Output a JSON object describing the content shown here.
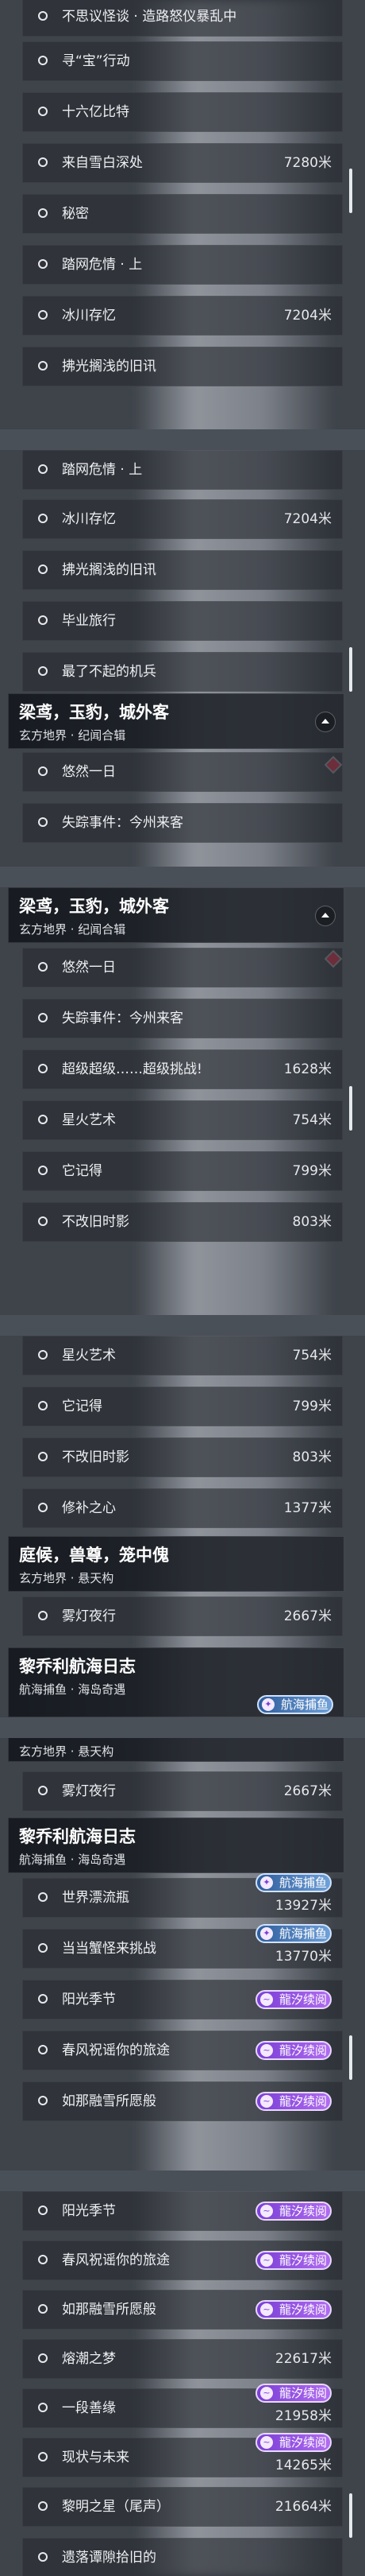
{
  "tags": {
    "longxi": "龍汐续阅",
    "hanghai": "航海捕鱼"
  },
  "chapters": {
    "liangniao": {
      "title": "梁鸢，玉豹，城外客",
      "sub": "玄方地界 · 纪闻合辑"
    },
    "tinghou": {
      "title": "庭候，兽尊，笼中傀",
      "sub": "玄方地界 · 悬天构"
    },
    "liqiao": {
      "title": "黎乔利航海日志",
      "sub": "航海捕鱼 · 海岛奇遇"
    }
  },
  "quests": {
    "q1": {
      "title": "不思议怪谈 · 造路怒仪暴乱中"
    },
    "q2": {
      "title": "寻“宝”行动"
    },
    "q3": {
      "title": "十六亿比特"
    },
    "q4": {
      "title": "来自雪白深处",
      "distance": "7280米"
    },
    "q5": {
      "title": "秘密"
    },
    "q6": {
      "title": "踏网危情 · 上"
    },
    "q7": {
      "title": "冰川存忆",
      "distance": "7204米"
    },
    "q8": {
      "title": "拂光搁浅的旧讯"
    },
    "q9": {
      "title": "毕业旅行"
    },
    "q10": {
      "title": "最了不起的机兵"
    },
    "q11": {
      "title": "悠然一日"
    },
    "q12": {
      "title": "失踪事件：今州来客"
    },
    "q13": {
      "title": "超级超级……超级挑战!",
      "distance": "1628米"
    },
    "q14": {
      "title": "星火艺术",
      "distance": "754米"
    },
    "q15": {
      "title": "它记得",
      "distance": "799米"
    },
    "q16": {
      "title": "不改旧时影",
      "distance": "803米"
    },
    "q17": {
      "title": "修补之心",
      "distance": "1377米"
    },
    "q18": {
      "title": "雾灯夜行",
      "distance": "2667米"
    },
    "q19": {
      "title": "世界漂流瓶",
      "distance": "13927米"
    },
    "q20": {
      "title": "当当蟹怪来挑战",
      "distance": "13770米"
    },
    "q21": {
      "title": "阳光季节"
    },
    "q22": {
      "title": "春风祝谣你的旅途"
    },
    "q23": {
      "title": "如那融雪所愿般"
    },
    "q24": {
      "title": "熔潮之梦",
      "distance": "22617米"
    },
    "q25": {
      "title": "一段善缘",
      "distance": "21958米"
    },
    "q26": {
      "title": "现状与未来",
      "distance": "14265米"
    },
    "q27": {
      "title": "黎明之星（尾声）",
      "distance": "21664米"
    },
    "q28": {
      "title": "遗落谭隙拾旧的"
    }
  },
  "colors": {
    "tag_purple": "#9a55e6",
    "tag_blue": "#4b7fc0",
    "marker_red": "#e0344b",
    "panel": "#262a30"
  }
}
